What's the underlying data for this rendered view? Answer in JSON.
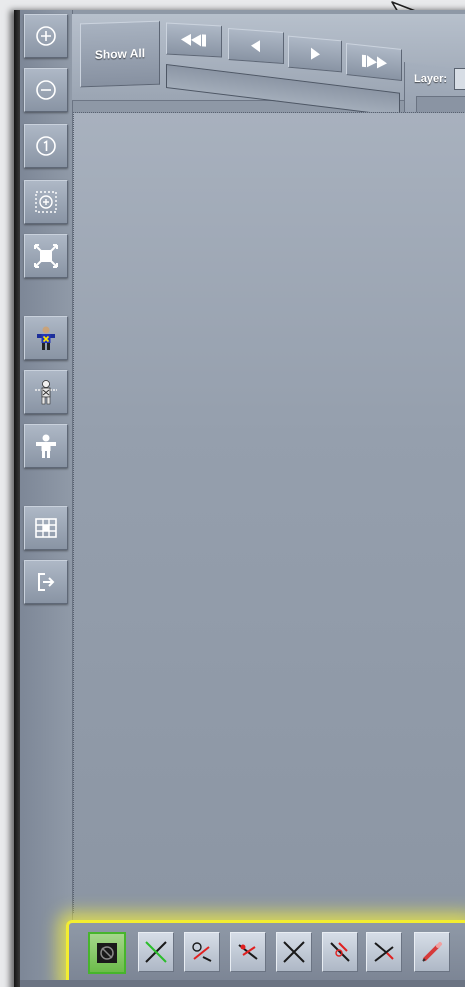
{
  "toolbar": {
    "show_all_label": "Show All",
    "layer_label": "Layer:",
    "nav": [
      {
        "name": "first-frame",
        "label": "◀◀▌"
      },
      {
        "name": "prev-frame",
        "label": "◀"
      },
      {
        "name": "next-frame",
        "label": "▶"
      },
      {
        "name": "last-frame",
        "label": "▶▶"
      }
    ]
  },
  "left_tools": [
    {
      "name": "zoom-in",
      "icon": "zoom-in-icon"
    },
    {
      "name": "zoom-out",
      "icon": "zoom-out-icon"
    },
    {
      "name": "zoom-reset",
      "icon": "zoom-one-icon"
    },
    {
      "name": "zoom-selection",
      "icon": "zoom-selection-icon"
    },
    {
      "name": "fit-to-screen",
      "icon": "fit-screen-icon"
    },
    {
      "name": "skeleton-character",
      "icon": "character-blue-icon"
    },
    {
      "name": "skeleton-bones",
      "icon": "character-bones-icon"
    },
    {
      "name": "skeleton-outline",
      "icon": "character-white-icon"
    },
    {
      "name": "spreadsheet",
      "icon": "grid-sheet-icon"
    },
    {
      "name": "export",
      "icon": "export-icon"
    }
  ],
  "mode_tools": [
    {
      "name": "skeleton-view",
      "icon": "skeleton-dark-icon",
      "active": true
    },
    {
      "name": "bone-tool",
      "icon": "bone-cross-icon",
      "active": false
    },
    {
      "name": "bone-rotate",
      "icon": "bone-rotate-icon",
      "active": false
    },
    {
      "name": "bone-move",
      "icon": "bone-move-icon",
      "active": false
    },
    {
      "name": "bone-cross",
      "icon": "bone-x-icon",
      "active": false
    },
    {
      "name": "bone-scale",
      "icon": "bone-scale-icon",
      "active": false
    },
    {
      "name": "bone-angle",
      "icon": "bone-angle-icon",
      "active": false
    },
    {
      "name": "bone-edit",
      "icon": "pencil-icon",
      "active": false
    }
  ],
  "colors": {
    "highlight": "#f3ee30",
    "active_tool": "#6cbc4a",
    "canvas": "#959fad"
  }
}
